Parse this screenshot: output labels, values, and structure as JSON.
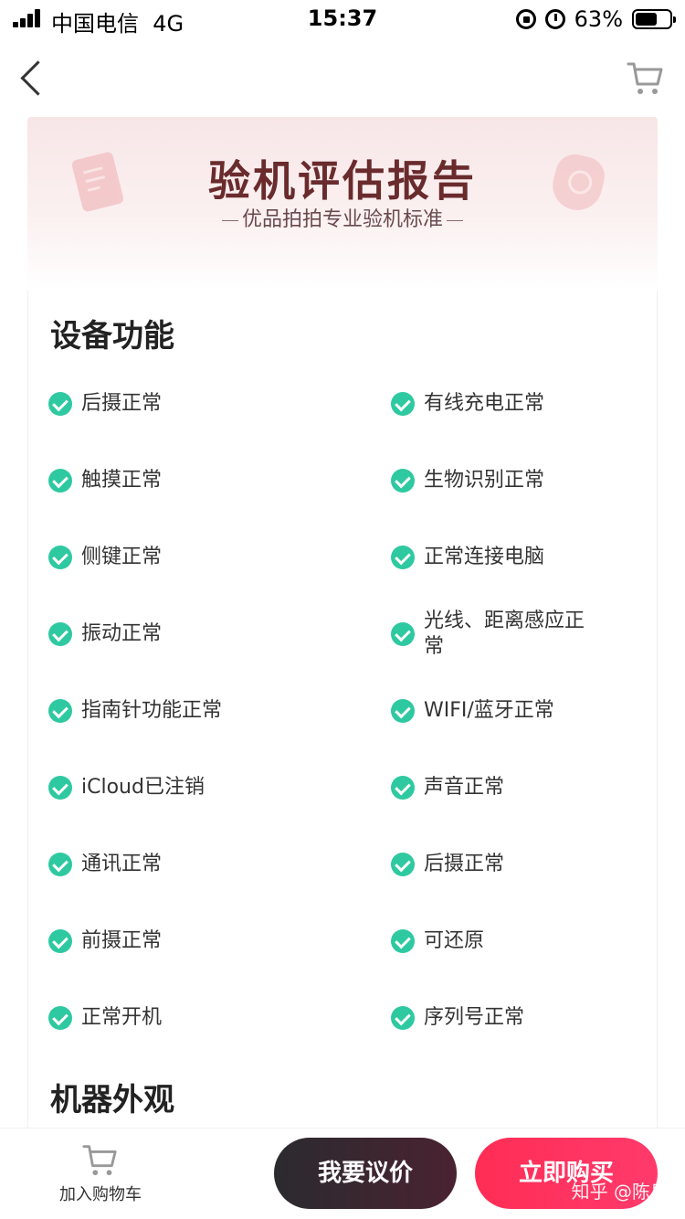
{
  "status_bar": {
    "carrier": "中国电信",
    "network": "4G",
    "time": "15:37",
    "battery_percent": "63%",
    "battery_level": 0.63,
    "icons": [
      "signal-icon",
      "orientation-lock-icon",
      "alarm-icon",
      "battery-icon"
    ]
  },
  "nav": {
    "back_icon": "chevron-left-icon",
    "cart_icon": "shopping-cart-icon"
  },
  "banner": {
    "title": "验机评估报告",
    "subtitle": "优品拍拍专业验机标准",
    "icons": [
      "document-check-icon",
      "shield-icon"
    ]
  },
  "report": {
    "section1_title": "设备功能",
    "items": [
      "后摄正常",
      "有线充电正常",
      "触摸正常",
      "生物识别正常",
      "侧键正常",
      "正常连接电脑",
      "振动正常",
      "光线、距离感应正常",
      "指南针功能正常",
      "WIFI/蓝牙正常",
      "iCloud已注销",
      "声音正常",
      "通讯正常",
      "后摄正常",
      "前摄正常",
      "可还原",
      "正常开机",
      "序列号正常"
    ],
    "section2_title": "机器外观"
  },
  "bottom_bar": {
    "add_cart_label": "加入购物车",
    "negotiate_label": "我要议价",
    "buy_label": "立即购买",
    "watermark": "知乎 @陈泉"
  },
  "colors": {
    "check": "#2ec9a0",
    "banner_title": "#6a2b2d",
    "buy_button": "#ff2d55",
    "negotiate_button": "#2b2b2f"
  }
}
